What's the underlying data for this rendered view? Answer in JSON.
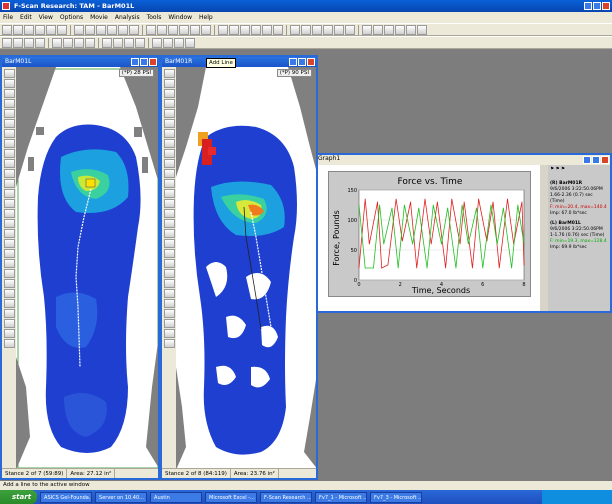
{
  "app": {
    "title": "F-Scan Research: TAM - BarM01L"
  },
  "menu": [
    "File",
    "Edit",
    "View",
    "Options",
    "Movie",
    "Analysis",
    "Tools",
    "Window",
    "Help"
  ],
  "left_window": {
    "title": "BarM01L",
    "psi_label": "(*P) 28 PSI",
    "status_stance": "Stance 2 of 7 (59:89)",
    "status_area": "Area: 27.12 in²"
  },
  "right_window": {
    "title": "BarM01R",
    "tooltip": "Add Line",
    "psi_label": "(*P) 90 PSI",
    "status_stance": "Stance 2 of 8 (84:119)",
    "status_area": "Area: 23.76 in²"
  },
  "graph_window": {
    "title": "Graph1",
    "legend": {
      "r_name": "(R) BarM01R",
      "r_date": "9/6/2006 3:22:50.06PM",
      "r_range": "1.66-2.36 (0.7) sec (Time)",
      "r_stats": "F: min=20.4, max=140.4",
      "r_imp": "Imp: 67.0 lb*sec",
      "l_name": "(L) BarM01L",
      "l_date": "9/6/2006 3:22:50.06PM",
      "l_range": "1-1.76 (0.76) sec (Time)",
      "l_stats": "F: min=19.3, max=128.4",
      "l_imp": "Imp: 69.9 lb*sec"
    }
  },
  "chart_data": {
    "type": "line",
    "title": "Force vs. Time",
    "xlabel": "Time, Seconds",
    "ylabel": "Force, Pounds",
    "xlim": [
      0,
      8
    ],
    "ylim": [
      0,
      150
    ],
    "x_ticks": [
      "0",
      "2",
      "4",
      "6",
      "8"
    ],
    "y_ticks": [
      "0",
      "50",
      "100",
      "150"
    ],
    "series": [
      {
        "color": "#e02020",
        "x": [
          0.0,
          0.3,
          0.5,
          0.9,
          1.1,
          1.4,
          1.8,
          2.1,
          2.5,
          2.8,
          3.2,
          3.5,
          3.8,
          4.2,
          4.5,
          4.9,
          5.1,
          5.5,
          5.8,
          6.2,
          6.5,
          6.8,
          7.2,
          7.5,
          7.9,
          8.0
        ],
        "y": [
          20,
          135,
          60,
          130,
          20,
          25,
          135,
          65,
          130,
          20,
          135,
          60,
          130,
          20,
          135,
          60,
          130,
          20,
          135,
          65,
          130,
          20,
          135,
          60,
          130,
          25
        ]
      },
      {
        "color": "#20c020",
        "x": [
          0.0,
          0.3,
          0.7,
          1.0,
          1.2,
          1.6,
          1.9,
          2.2,
          2.6,
          2.9,
          3.3,
          3.6,
          4.0,
          4.3,
          4.7,
          5.0,
          5.3,
          5.7,
          6.0,
          6.4,
          6.7,
          7.0,
          7.4,
          7.7,
          8.0
        ],
        "y": [
          125,
          20,
          20,
          125,
          60,
          120,
          20,
          125,
          60,
          120,
          20,
          125,
          60,
          120,
          20,
          125,
          60,
          120,
          20,
          125,
          60,
          120,
          20,
          125,
          60
        ]
      }
    ]
  },
  "statusbar": {
    "text": "Add a line to the active window"
  },
  "taskbar": {
    "start": "start",
    "tasks": [
      "ASICS Gel-Founda...",
      "Server on 10.40...",
      "Austin",
      "Microsoft Excel -...",
      "F-Scan Research ...",
      "Fv7_1 - Microsoft ...",
      "Fv7_3 - Microsoft ..."
    ]
  }
}
